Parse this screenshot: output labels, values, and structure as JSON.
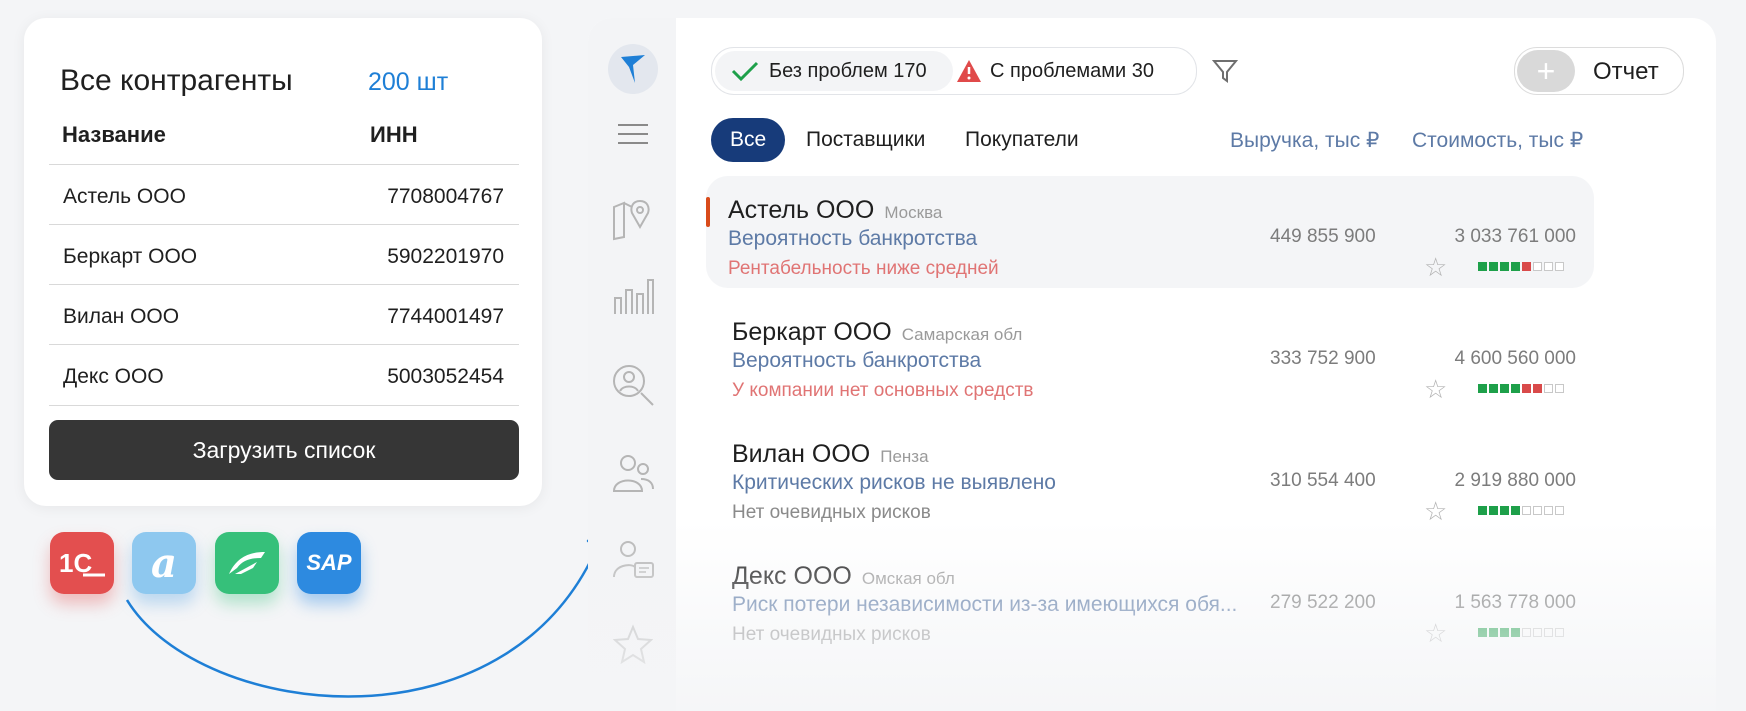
{
  "contractors_card": {
    "title": "Все контрагенты",
    "count": "200 шт",
    "columns": {
      "name": "Название",
      "inn": "ИНН"
    },
    "rows": [
      {
        "name": "Астель ООО",
        "inn": "7708004767"
      },
      {
        "name": "Беркарт ООО",
        "inn": "5902201970"
      },
      {
        "name": "Вилан ООО",
        "inn": "7744001497"
      },
      {
        "name": "Декс ООО",
        "inn": "5003052454"
      }
    ],
    "upload_label": "Загрузить список"
  },
  "integrations": [
    {
      "icon": "1c-logo-icon",
      "label": "1С"
    },
    {
      "icon": "alfa-logo-icon",
      "label": "а"
    },
    {
      "icon": "green-wing-logo-icon",
      "label": ""
    },
    {
      "icon": "sap-logo-icon",
      "label": "SAP"
    }
  ],
  "colors": {
    "accent_blue": "#1e7fd6",
    "nav_blue": "#173b7a",
    "link_blue": "#5d7aa6",
    "risk_red": "#e07474",
    "score_green": "#1ea04a",
    "score_red": "#d94a4a",
    "dark_button": "#363636"
  },
  "sidebar": {
    "icons": [
      "logo-icon",
      "menu-icon",
      "map-pin-icon",
      "bar-chart-icon",
      "person-search-icon",
      "people-icon",
      "person-chat-icon",
      "star-icon"
    ]
  },
  "header": {
    "filter_ok": "Без проблем 170",
    "filter_bad": "С проблемами 30",
    "report_plus": "+",
    "report_label": "Отчет"
  },
  "tabs": [
    "Все",
    "Поставщики",
    "Покупатели"
  ],
  "columns": {
    "revenue": "Выручка, тыс ₽",
    "cost": "Стоимость, тыс ₽"
  },
  "companies": [
    {
      "name": "Астель ООО",
      "city": "Москва",
      "risk": "Вероятность банкротства",
      "note": "Рентабельность ниже средней",
      "revenue": "449 855 900",
      "cost": "3 033 761 000",
      "score": "4 of 8 green, 1 red"
    },
    {
      "name": "Беркарт ООО",
      "city": "Самарская обл",
      "risk": "Вероятность банкротства",
      "note": "У компании нет основных средств",
      "revenue": "333 752 900",
      "cost": "4 600 560 000",
      "score": "4 of 8 green, 2 red"
    },
    {
      "name": "Вилан ООО",
      "city": "Пенза",
      "risk": "Критических рисков не выявлено",
      "note": "Нет очевидных рисков",
      "revenue": "310 554 400",
      "cost": "2 919 880 000",
      "score": "4 of 8 green"
    },
    {
      "name": "Декс ООО",
      "city": "Омская обл",
      "risk": "Риск потери независимости из-за имеющихся обя...",
      "note": "Нет очевидных рисков",
      "revenue": "279 522 200",
      "cost": "1 563 778 000",
      "score": "4 of 8 green"
    }
  ]
}
